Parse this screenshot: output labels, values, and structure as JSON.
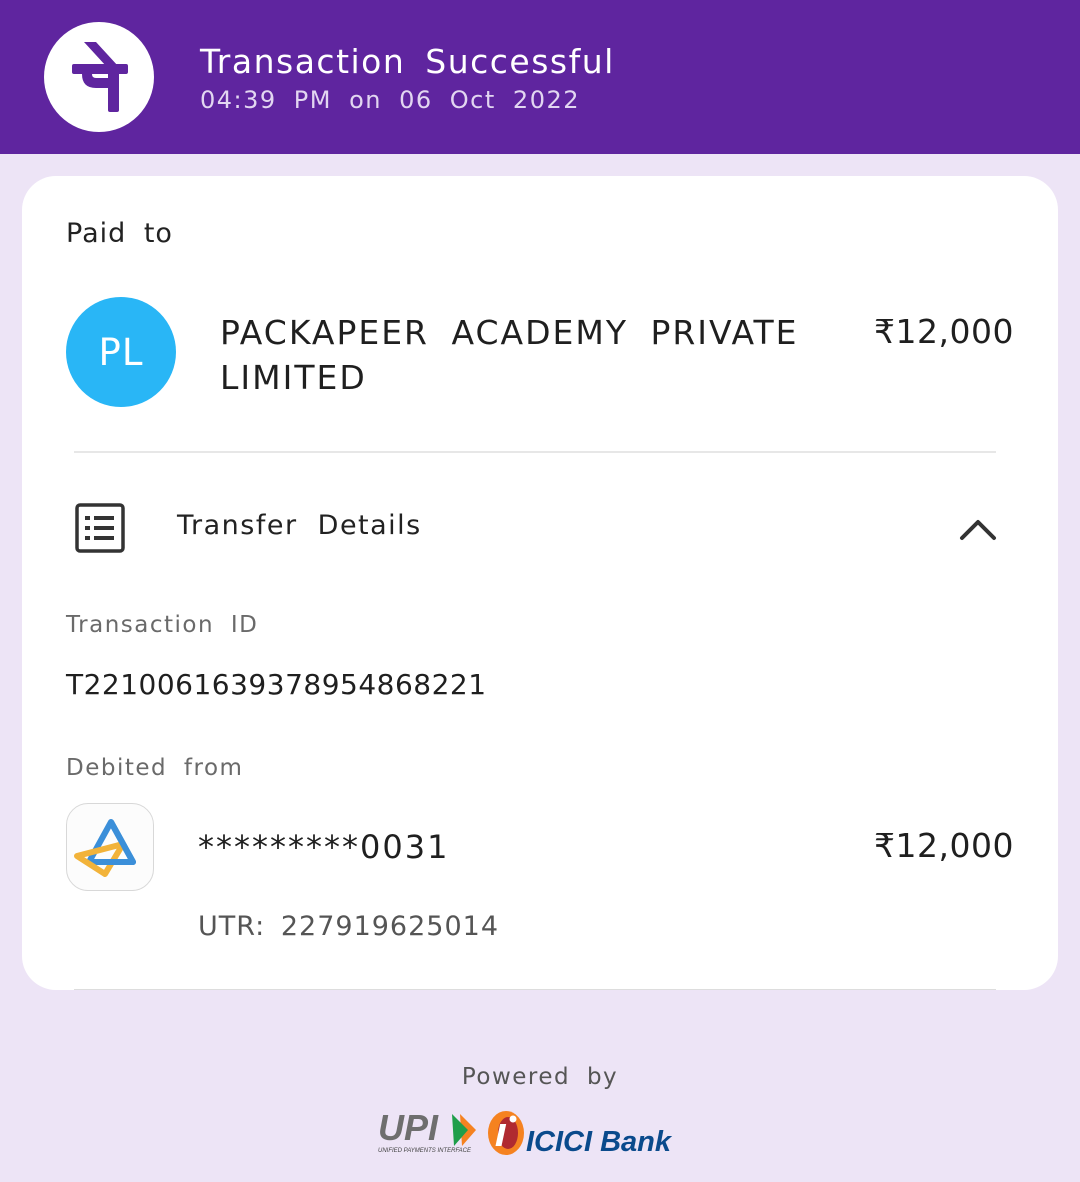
{
  "header": {
    "title": "Transaction Successful",
    "timestamp": "04:39 PM on 06 Oct 2022",
    "logo_icon": "phonepe-logo-icon",
    "color": "#5f259f"
  },
  "payee": {
    "section_label": "Paid to",
    "initials": "PL",
    "name": "PACKAPEER ACADEMY PRIVATE LIMITED",
    "amount": "₹12,000",
    "avatar_color": "#29b6f6"
  },
  "transfer_details": {
    "label": "Transfer Details",
    "icon": "receipt-list-icon",
    "toggle_icon": "chevron-up-icon",
    "transaction_id_label": "Transaction ID",
    "transaction_id": "T2210061639378954868221",
    "debited_from_label": "Debited from",
    "bank_icon": "sbi-bank-icon",
    "account_number": "*********0031",
    "amount": "₹12,000",
    "utr": "UTR: 227919625014"
  },
  "footer": {
    "powered_by": "Powered by",
    "upi_logo": "UPI",
    "upi_tagline": "UNIFIED PAYMENTS INTERFACE",
    "bank_logo": "ICICI Bank"
  }
}
